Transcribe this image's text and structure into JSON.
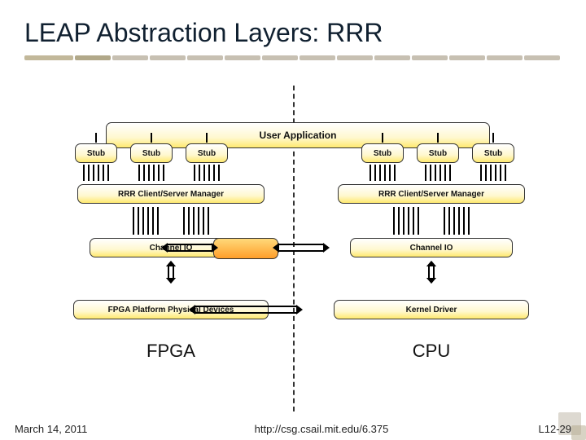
{
  "title": "LEAP Abstraction Layers: RRR",
  "user_application": "User Application",
  "stub": "Stub",
  "manager": "RRR Client/Server Manager",
  "channel_io": "Channel IO",
  "fpga_platform": "FPGA Platform Physical Devices",
  "kernel_driver": "Kernel Driver",
  "fpga_label": "FPGA",
  "cpu_label": "CPU",
  "footer": {
    "date": "March 14, 2011",
    "url": "http://csg.csail.mit.edu/6.375",
    "slide_num": "L12-29"
  }
}
